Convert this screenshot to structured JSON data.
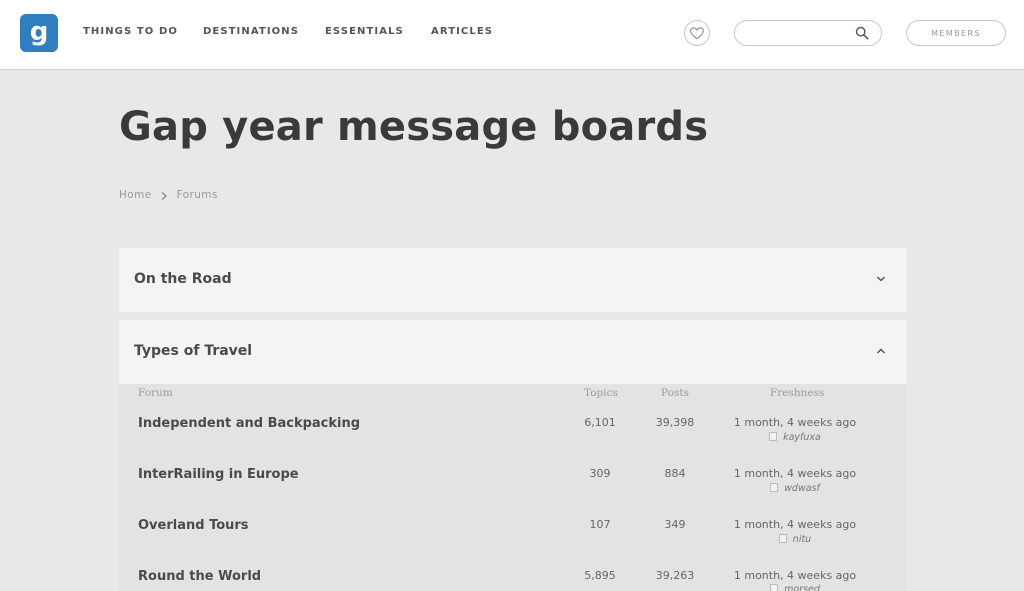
{
  "nav": {
    "links": [
      "THINGS TO DO",
      "DESTINATIONS",
      "ESSENTIALS",
      "ARTICLES"
    ],
    "members_label": "MEMBERS",
    "search_placeholder": "",
    "brand_color": "#2e7ec0"
  },
  "page": {
    "title": "Gap year message boards",
    "breadcrumb": [
      "Home",
      "Forums"
    ]
  },
  "panels": [
    {
      "label": "On the Road",
      "expanded": false
    },
    {
      "label": "Types of Travel",
      "expanded": true
    }
  ],
  "table": {
    "columns": [
      "Forum",
      "Topics",
      "Posts",
      "Freshness"
    ],
    "rows": [
      {
        "name": "Independent and Backpacking",
        "topics": "6,101",
        "posts": "39,398",
        "freshness": "1 month, 4 weeks ago",
        "user": "kayfuxa"
      },
      {
        "name": "InterRailing in Europe",
        "topics": "309",
        "posts": "884",
        "freshness": "1 month, 4 weeks ago",
        "user": "wdwasf"
      },
      {
        "name": "Overland Tours",
        "topics": "107",
        "posts": "349",
        "freshness": "1 month, 4 weeks ago",
        "user": "nitu"
      },
      {
        "name": "Round the World",
        "topics": "5,895",
        "posts": "39,263",
        "freshness": "1 month, 4 weeks ago",
        "user": "morsed"
      }
    ]
  }
}
